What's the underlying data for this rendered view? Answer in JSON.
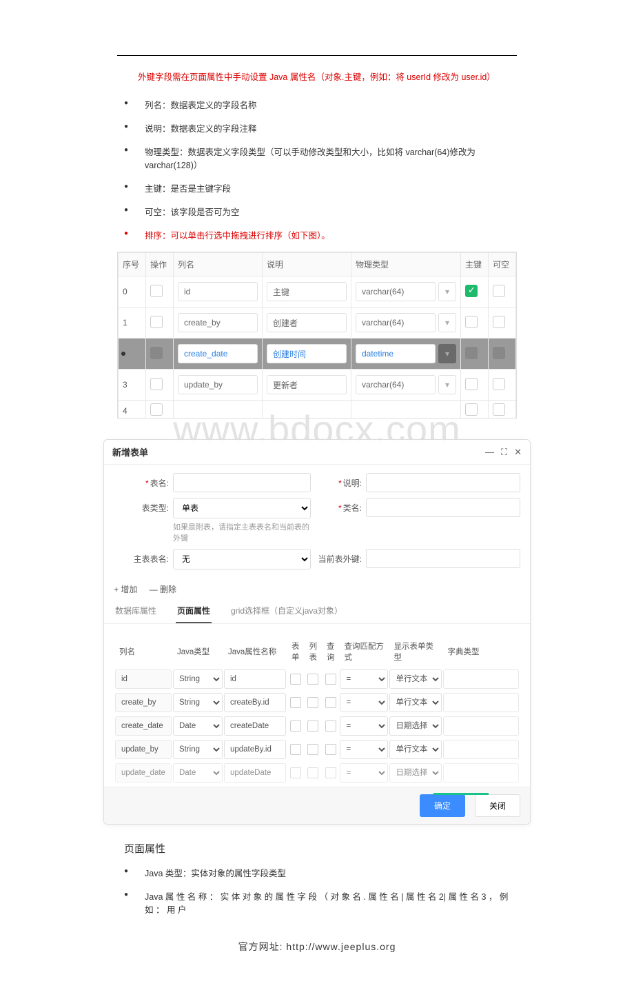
{
  "note_red1": "外键字段需在页面属性中手动设置 Java 属性名（对象.主键，例如：将 userId 修改为 user.id）",
  "bullets_top": [
    {
      "text": "列名：数据表定义的字段名称",
      "red": false
    },
    {
      "text": "说明：数据表定义的字段注释",
      "red": false
    },
    {
      "text": "物理类型：数据表定义字段类型（可以手动修改类型和大小，比如将 varchar(64)修改为 varchar(128)）",
      "red": false
    },
    {
      "text": "主键：是否是主键字段",
      "red": false
    },
    {
      "text": "可空：该字段是否可为空",
      "red": false
    },
    {
      "text": "排序：可以单击行选中拖拽进行排序（如下图）。",
      "red": true
    }
  ],
  "tbl1": {
    "headers": {
      "seq": "序号",
      "op": "操作",
      "col": "列名",
      "desc": "说明",
      "ptype": "物理类型",
      "pk": "主键",
      "nul": "可空"
    },
    "rows": [
      {
        "seq": "0",
        "col": "id",
        "desc": "主键",
        "ptype": "varchar(64)",
        "pk": true,
        "nul": false,
        "dragging": false
      },
      {
        "seq": "1",
        "col": "create_by",
        "desc": "创建者",
        "ptype": "varchar(64)",
        "pk": false,
        "nul": false,
        "dragging": false
      },
      {
        "seq": "",
        "col": "create_date",
        "desc": "创建时间",
        "ptype": "datetime",
        "pk": false,
        "nul": false,
        "dragging": true
      },
      {
        "seq": "3",
        "col": "update_by",
        "desc": "更新者",
        "ptype": "varchar(64)",
        "pk": false,
        "nul": false,
        "dragging": false
      }
    ]
  },
  "watermark": "www.bdocx.com",
  "dlg": {
    "title": "新增表单",
    "labels": {
      "tableName": "表名:",
      "desc": "说明:",
      "tableType": "表类型:",
      "className": "类名:",
      "mainTable": "主表表名:",
      "fk": "当前表外键:"
    },
    "tableType_value": "单表",
    "tableType_hint": "如果是附表，请指定主表表名和当前表的外键",
    "mainTable_value": "无",
    "toolbar": {
      "add": "+ 增加",
      "del": "— 删除"
    },
    "tabs": {
      "db": "数据库属性",
      "page": "页面属性",
      "grid": "grid选择框（自定义java对象）"
    },
    "tbl2": {
      "headers": {
        "col": "列名",
        "javaType": "Java类型",
        "javaProp": "Java属性名称",
        "form": "表单",
        "list": "列表",
        "query": "查询",
        "queryMatch": "查询匹配方式",
        "formType": "显示表单类型",
        "dict": "字典类型"
      },
      "rows": [
        {
          "col": "id",
          "javaType": "String",
          "javaProp": "id",
          "queryMatch": "=",
          "formType": "单行文本"
        },
        {
          "col": "create_by",
          "javaType": "String",
          "javaProp": "createBy.id",
          "queryMatch": "=",
          "formType": "单行文本"
        },
        {
          "col": "create_date",
          "javaType": "Date",
          "javaProp": "createDate",
          "queryMatch": "=",
          "formType": "日期选择"
        },
        {
          "col": "update_by",
          "javaType": "String",
          "javaProp": "updateBy.id",
          "queryMatch": "=",
          "formType": "单行文本"
        },
        {
          "col": "update_date",
          "javaType": "Date",
          "javaProp": "updateDate",
          "queryMatch": "=",
          "formType": "日期选择"
        }
      ]
    },
    "buttons": {
      "ok": "确定",
      "close": "关闭"
    }
  },
  "section_title": "页面属性",
  "bullets_bottom": [
    "Java 类型：实体对象的属性字段类型",
    "Java 属 性 名 称 ： 实 体 对 象 的 属 性 字 段 （ 对 象 名 . 属 性 名 | 属 性 名 2| 属 性 名 3 ， 例 如 ： 用 户"
  ],
  "footer_url": "官方网址: http://www.jeeplus.org"
}
